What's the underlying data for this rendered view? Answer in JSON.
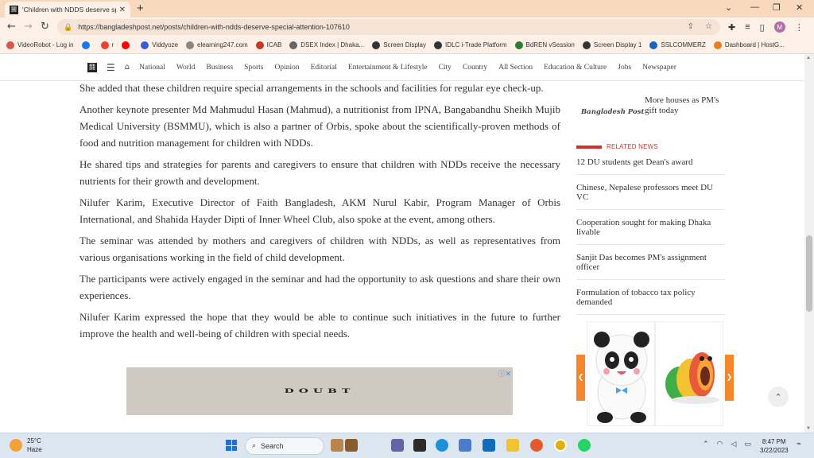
{
  "browser": {
    "tab_title": "'Children with NDDS deserve spe",
    "tab_favicon": "鬪",
    "url": "https://bangladeshpost.net/posts/children-with-ndds-deserve-special-attention-107610",
    "bookmarks": [
      {
        "label": "VideoRobot - Log in",
        "color": "#d9534f"
      },
      {
        "label": "",
        "color": "#1877f2"
      },
      {
        "label": "r",
        "color": "#ea4335"
      },
      {
        "label": "",
        "color": "#ff0000"
      },
      {
        "label": "Viddyoze",
        "color": "#3b5bdb"
      },
      {
        "label": "elearning247.com",
        "color": "#888888"
      },
      {
        "label": "ICAB",
        "color": "#c0392b"
      },
      {
        "label": "DSEX Index | Dhaka...",
        "color": "#666666"
      },
      {
        "label": "Screen Display",
        "color": "#333333"
      },
      {
        "label": "IDLC i-Trade Platform",
        "color": "#333333"
      },
      {
        "label": "BdREN vSession",
        "color": "#2e7d32"
      },
      {
        "label": "Screen Display 1",
        "color": "#333333"
      },
      {
        "label": "SSLCOMMERZ",
        "color": "#1565c0"
      },
      {
        "label": "Dashboard | HostG...",
        "color": "#e67e22"
      }
    ],
    "avatar_letter": "M"
  },
  "site_nav": {
    "logo": "鬪",
    "items": [
      "National",
      "World",
      "Business",
      "Sports",
      "Opinion",
      "Editorial",
      "Entertainment & Lifestyle",
      "City",
      "Country",
      "All Section",
      "Education & Culture",
      "Jobs",
      "Newspaper"
    ]
  },
  "article": {
    "paragraphs": [
      "She added that these children require special arrangements in the schools and facilities for regular eye check-up.",
      "Another keynote presenter Md Mahmudul Hasan (Mahmud), a nutritionist from IPNA, Bangabandhu Sheikh Mujib Medical University (BSMMU), which is also a partner of Orbis, spoke about the scientifically-proven methods of food and nutrition management for children with NDDs.",
      "He shared tips and strategies for parents and caregivers to ensure that children with NDDs receive the necessary nutrients for their growth and development.",
      "Nilufer Karim, Executive Director of Faith Bangladesh, AKM Nurul Kabir, Program Manager of Orbis International, and Shahida Hayder Dipti of Inner Wheel Club, also spoke at the event, among others.",
      "The seminar was attended by mothers and caregivers of children with NDDs, as well as representatives from various organisations working in the field of child development.",
      " The participants were actively engaged in the seminar and had the opportunity to ask questions and share their own experiences.",
      " Nilufer Karim expressed the hope that they would be able to continue such initiatives in the future to further improve the health and well-being of children with special needs."
    ]
  },
  "ad": {
    "text": "DOUBT",
    "badge": "ⓘ✕"
  },
  "sidebar": {
    "promo_logo": "Bangladesh Post",
    "promo_title": "More houses as PM's gift today",
    "related_heading": "RELATED NEWS",
    "related": [
      "12 DU students get Dean's award",
      "Chinese, Nepalese professors meet DU VC",
      "Cooperation sought for making Dhaka livable",
      "Sanjit Das becomes PM's assignment officer",
      "Formulation of tobacco tax policy demanded"
    ]
  },
  "taskbar": {
    "temperature": "25°C",
    "weather": "Haze",
    "search_label": "Search",
    "time": "8:47 PM",
    "date": "3/22/2023"
  }
}
